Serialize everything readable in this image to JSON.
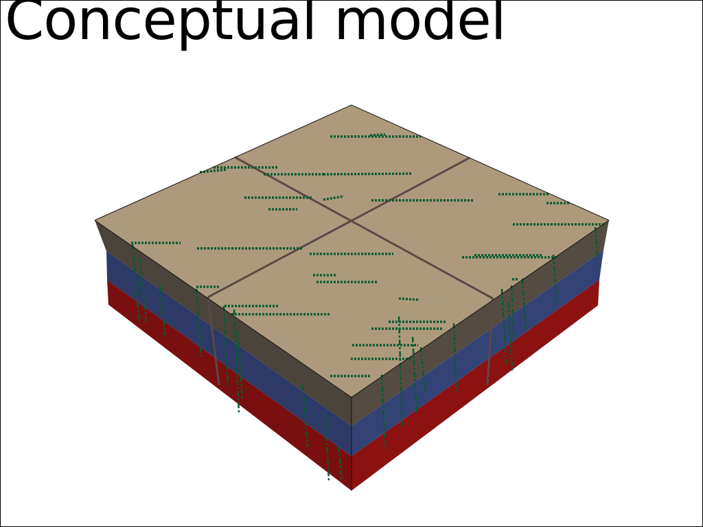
{
  "title": "Conceptual model",
  "colors": {
    "background": "#ffffff",
    "title": "#000000",
    "top_surface": "#ad9a7c",
    "layer_upper": "#4b443c",
    "layer_middle": "#2d3a67",
    "layer_lower": "#7a0f0f",
    "fault_line": "#5a4a46",
    "fracture_marks": "#0b5a32",
    "edge": "#111111"
  },
  "model": {
    "layers_top_to_bottom": [
      "upper",
      "middle",
      "lower"
    ],
    "faults_on_top_surface": 2
  }
}
